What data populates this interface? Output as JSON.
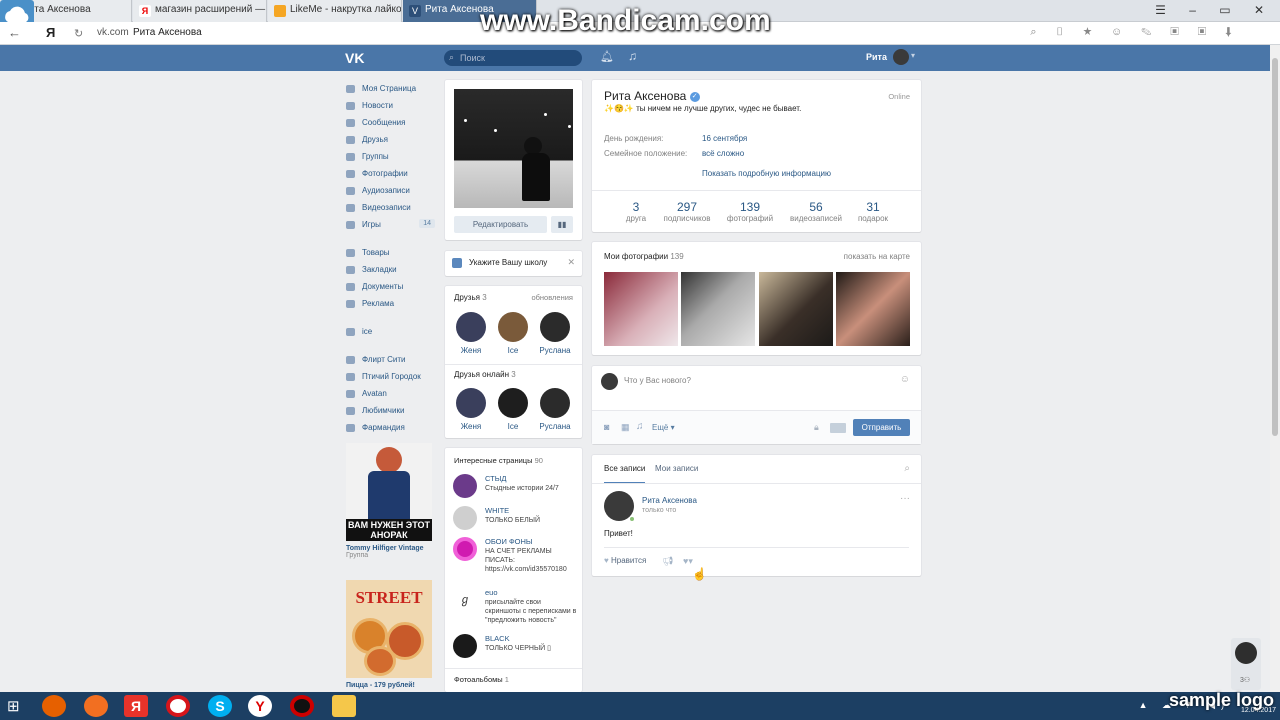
{
  "browser": {
    "tabs": [
      "Рита Аксенова",
      "магазин расширений — Я",
      "LikeMe - накрутка лайков и",
      "Рита Аксенова"
    ],
    "address_domain": "vk.com",
    "address_title": "Рита Аксенова",
    "yandex_mark": "Я"
  },
  "watermark": "www.Bandicam.com",
  "header": {
    "search_placeholder": "Поиск",
    "user_name": "Рита"
  },
  "nav": {
    "items": [
      "Моя Страница",
      "Новости",
      "Сообщения",
      "Друзья",
      "Группы",
      "Фотографии",
      "Аудиозаписи",
      "Видеозаписи",
      "Игры"
    ],
    "games_count": "14",
    "items2": [
      "Товары",
      "Закладки",
      "Документы",
      "Реклама"
    ],
    "items3": [
      "ice"
    ],
    "items4": [
      "Флирт Сити",
      "Птичий Городок",
      "Avatan",
      "Любимчики",
      "Фармандия"
    ]
  },
  "ads": [
    {
      "banner": "ВАМ НУЖЕН ЭТОТ АНОРАК",
      "title": "Tommy Hilfiger Vintage",
      "sub": "Группа"
    },
    {
      "banner": "STREET",
      "title": "Пицца - 179 рублей!"
    }
  ],
  "profile": {
    "edit_button": "Редактировать",
    "name": "Рита Аксенова",
    "status": "✨😚✨ ты ничем не лучше других, чудес не бывает.",
    "online": "Online",
    "birthday_label": "День рождения:",
    "birthday": "16 сентября",
    "family_label": "Семейное положение:",
    "family": "всё сложно",
    "more_info": "Показать подробную информацию",
    "stats": [
      {
        "n": "3",
        "l": "друга"
      },
      {
        "n": "297",
        "l": "подписчиков"
      },
      {
        "n": "139",
        "l": "фотографий"
      },
      {
        "n": "56",
        "l": "видеозаписей"
      },
      {
        "n": "31",
        "l": "подарок"
      }
    ]
  },
  "school": {
    "text": "Укажите Вашу школу"
  },
  "friends": {
    "title": "Друзья",
    "count": "3",
    "updates": "обновления",
    "list": [
      "Женя",
      "Ice",
      "Руслана"
    ],
    "online_title": "Друзья онлайн",
    "online_count": "3",
    "online_list": [
      "Женя",
      "Ice",
      "Руслана"
    ]
  },
  "pages": {
    "title": "Интересные страницы",
    "count": "90",
    "list": [
      {
        "name": "СТЫД",
        "desc": "Стыдные истории 24/7"
      },
      {
        "name": "WHITE",
        "desc": "ТОЛЬКО БЕЛЫЙ"
      },
      {
        "name": "ОБОИ ФОНЫ",
        "desc": "НА СЧЕТ РЕКЛАМЫ ПИСАТЬ: https://vk.com/id35570180"
      },
      {
        "name": "euo",
        "desc": "присылайте свои скриншоты с переписками в \"предложить новость\""
      },
      {
        "name": "BLACK",
        "desc": "ТОЛЬКО ЧЕРНЫЙ ▯"
      }
    ],
    "albums_title": "Фотоальбомы",
    "albums_count": "1"
  },
  "photos": {
    "title": "Мои фотографии",
    "count": "139",
    "map_link": "показать на карте"
  },
  "composer": {
    "placeholder": "Что у Вас нового?",
    "more": "Ещё",
    "send": "Отправить"
  },
  "wall": {
    "tabs": [
      "Все записи",
      "Мои записи"
    ],
    "post": {
      "author": "Рита Аксенова",
      "time": "только что",
      "text": "Привет!",
      "like": "Нравится"
    }
  },
  "side_counter": "3",
  "clock": "12.04.2017",
  "sample_logo": "sample logo"
}
